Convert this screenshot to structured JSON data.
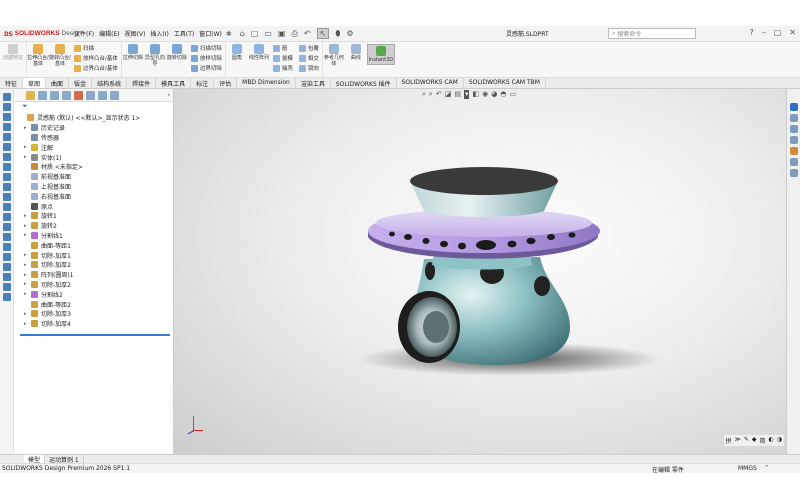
{
  "app": {
    "logo_brand": "SOLIDWORKS",
    "logo_suffix": "Design",
    "document_title": "灵感筋.SLDPRT",
    "search_placeholder": "搜索命令"
  },
  "menus": [
    "文件(F)",
    "编辑(E)",
    "视图(V)",
    "插入(I)",
    "工具(T)",
    "窗口(W)"
  ],
  "command_manager": {
    "group1": {
      "label": "创建特征"
    },
    "group2": [
      {
        "label": "拉伸凸台/基体"
      },
      {
        "label": "旋转凸台/基体"
      },
      {
        "label": "扫描"
      },
      {
        "label": "放样凸台/基体"
      },
      {
        "label": "边界凸台/基体"
      }
    ],
    "group3": [
      {
        "label": "拉伸切除"
      },
      {
        "label": "异型孔向导"
      },
      {
        "label": "旋转切除"
      },
      {
        "label": "扫描切除"
      },
      {
        "label": "放样切除"
      },
      {
        "label": "边界切除"
      }
    ],
    "group4": [
      {
        "label": "圆角"
      },
      {
        "label": "线性阵列"
      },
      {
        "label": "筋"
      },
      {
        "label": "拔模"
      },
      {
        "label": "抽壳"
      },
      {
        "label": "包覆"
      },
      {
        "label": "相交"
      },
      {
        "label": "镜向"
      }
    ],
    "group5": [
      {
        "label": "参考几何体"
      },
      {
        "label": "曲线"
      },
      {
        "label": "Instant3D"
      }
    ]
  },
  "tabs": [
    "特征",
    "草图",
    "曲面",
    "钣金",
    "结构系统",
    "焊接件",
    "模具工具",
    "标注",
    "评估",
    "MBD Dimension",
    "渲染工具",
    "SOLIDWORKS 插件",
    "SOLIDWORKS CAM",
    "SOLIDWORKS CAM TBM"
  ],
  "feature_tree": [
    {
      "label": "灵感筋 (默认) <<默认>_显示状态 1>",
      "level": 0,
      "expand": "",
      "color": "#d9a54a"
    },
    {
      "label": "历史记录",
      "level": 1,
      "expand": "▸",
      "color": "#7a8fa6"
    },
    {
      "label": "传感器",
      "level": 1,
      "expand": "",
      "color": "#7a8fa6"
    },
    {
      "label": "注解",
      "level": 1,
      "expand": "▸",
      "color": "#d8b23a"
    },
    {
      "label": "实体(1)",
      "level": 1,
      "expand": "▸",
      "color": "#8a8a8a"
    },
    {
      "label": "材质 <未指定>",
      "level": 1,
      "expand": "",
      "color": "#c98b3a"
    },
    {
      "label": "前视基准面",
      "level": 1,
      "expand": "",
      "color": "#9ab0cc"
    },
    {
      "label": "上视基准面",
      "level": 1,
      "expand": "",
      "color": "#9ab0cc"
    },
    {
      "label": "右视基准面",
      "level": 1,
      "expand": "",
      "color": "#9ab0cc"
    },
    {
      "label": "原点",
      "level": 1,
      "expand": "",
      "color": "#555555"
    },
    {
      "label": "旋转1",
      "level": 1,
      "expand": "▸",
      "color": "#c8a040"
    },
    {
      "label": "旋转2",
      "level": 1,
      "expand": "▸",
      "color": "#c8a040"
    },
    {
      "label": "分割线1",
      "level": 1,
      "expand": "▸",
      "color": "#b46ad0"
    },
    {
      "label": "曲面-等距1",
      "level": 1,
      "expand": "",
      "color": "#c8a040"
    },
    {
      "label": "切除-加厚1",
      "level": 1,
      "expand": "▸",
      "color": "#c8a040"
    },
    {
      "label": "切除-加厚2",
      "level": 1,
      "expand": "▸",
      "color": "#c8a040"
    },
    {
      "label": "阵列(圆周)1",
      "level": 1,
      "expand": "▸",
      "color": "#c8a040"
    },
    {
      "label": "切除-加厚2",
      "level": 1,
      "expand": "▸",
      "color": "#c8a040"
    },
    {
      "label": "分割线2",
      "level": 1,
      "expand": "▸",
      "color": "#b46ad0"
    },
    {
      "label": "曲面-等距2",
      "level": 1,
      "expand": "",
      "color": "#c8a040"
    },
    {
      "label": "切除-加厚3",
      "level": 1,
      "expand": "▸",
      "color": "#c8a040"
    },
    {
      "label": "切除-加厚4",
      "level": 1,
      "expand": "▸",
      "color": "#c8a040"
    }
  ],
  "model": {
    "body_color": "#8fc2c4",
    "disc_color": "#b69be0",
    "cap_color": "#3a3a3a"
  },
  "mini_toolbar": [
    "拼",
    "≫",
    "✎",
    "◆",
    "简",
    "◐",
    "◑"
  ],
  "bottom_tabs": [
    "模型",
    "运动算例 1"
  ],
  "status": {
    "left": "SOLIDWORKS Design Premium 2026 SP1.1",
    "mode": "在编辑 零件",
    "units": "MMGS"
  }
}
